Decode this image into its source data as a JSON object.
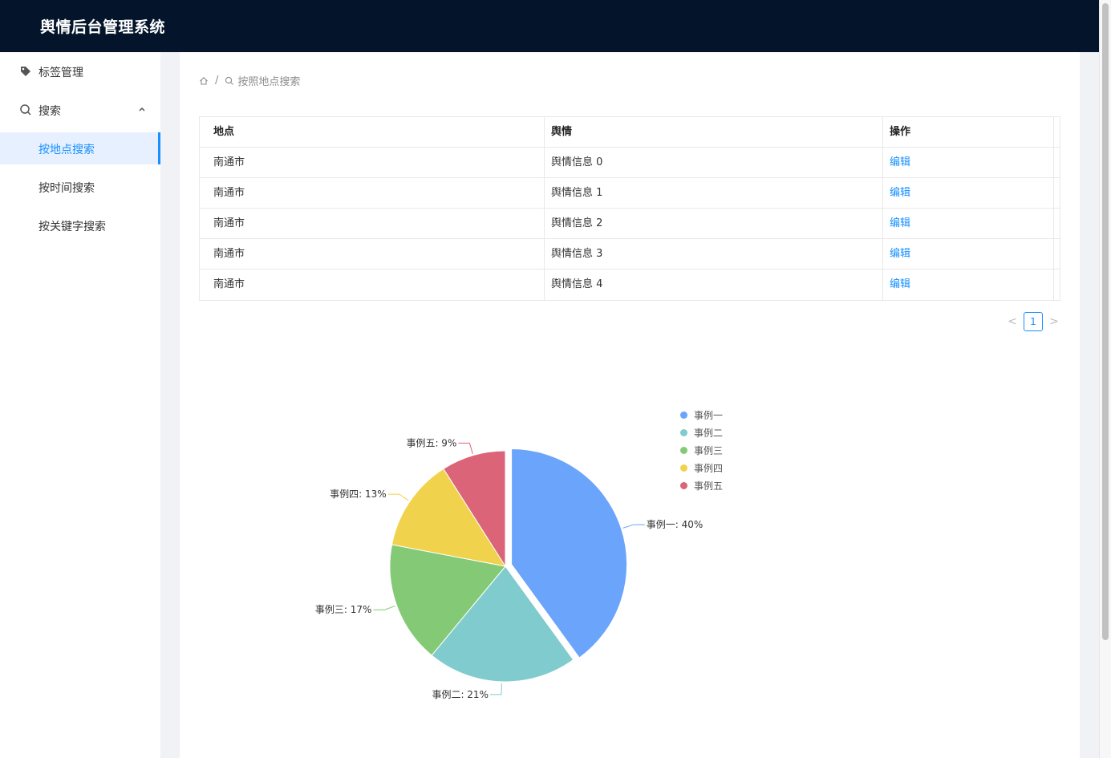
{
  "header": {
    "title": "舆情后台管理系统"
  },
  "sidebar": {
    "items": [
      {
        "label": "标签管理",
        "icon": "tag-icon"
      },
      {
        "label": "搜索",
        "icon": "search-icon"
      },
      {
        "label": "按地点搜索"
      },
      {
        "label": "按时间搜索"
      },
      {
        "label": "按关键字搜索"
      }
    ]
  },
  "breadcrumb": {
    "home_icon": "home-icon",
    "sep": "/",
    "search_icon": "search-icon",
    "current": "按照地点搜索"
  },
  "table": {
    "columns": [
      "地点",
      "舆情",
      "操作"
    ],
    "rows": [
      {
        "place": "南通市",
        "info": "舆情信息 0",
        "action": "编辑"
      },
      {
        "place": "南通市",
        "info": "舆情信息 1",
        "action": "编辑"
      },
      {
        "place": "南通市",
        "info": "舆情信息 2",
        "action": "编辑"
      },
      {
        "place": "南通市",
        "info": "舆情信息 3",
        "action": "编辑"
      },
      {
        "place": "南通市",
        "info": "舆情信息 4",
        "action": "编辑"
      }
    ]
  },
  "pagination": {
    "prev": "<",
    "current": "1",
    "next": ">"
  },
  "chart_data": {
    "type": "pie",
    "categories": [
      "事例一",
      "事例二",
      "事例三",
      "事例四",
      "事例五"
    ],
    "values": [
      40,
      21,
      17,
      13,
      9
    ],
    "labels": [
      "事例一: 40%",
      "事例二: 21%",
      "事例三: 17%",
      "事例四: 13%",
      "事例五: 9%"
    ],
    "colors": [
      "#6ba4fb",
      "#80cbcd",
      "#84ca76",
      "#f0d24c",
      "#db6478"
    ],
    "legend_position": "top-right"
  }
}
